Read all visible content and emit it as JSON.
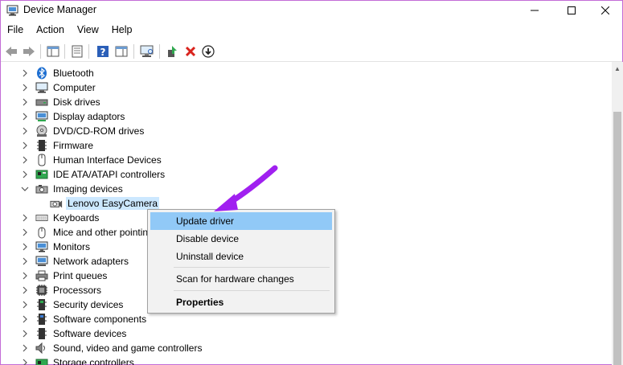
{
  "window": {
    "title": "Device Manager",
    "controls": {
      "minimize": "—",
      "maximize": "☐",
      "close": "✕"
    }
  },
  "menubar": {
    "items": [
      "File",
      "Action",
      "View",
      "Help"
    ]
  },
  "toolbar": {
    "buttons": [
      "back-icon",
      "forward-icon",
      "show-hide-console-tree-icon",
      "properties-icon",
      "help-icon",
      "action-pane-icon",
      "scan-hardware-icon",
      "enable-device-icon",
      "uninstall-device-icon",
      "update-driver-icon"
    ]
  },
  "tree": {
    "items": [
      {
        "label": "Bluetooth",
        "icon": "bluetooth-icon",
        "expanded": false
      },
      {
        "label": "Computer",
        "icon": "computer-icon",
        "expanded": false
      },
      {
        "label": "Disk drives",
        "icon": "disk-drive-icon",
        "expanded": false
      },
      {
        "label": "Display adaptors",
        "icon": "display-adapter-icon",
        "expanded": false
      },
      {
        "label": "DVD/CD-ROM drives",
        "icon": "dvd-drive-icon",
        "expanded": false
      },
      {
        "label": "Firmware",
        "icon": "firmware-icon",
        "expanded": false
      },
      {
        "label": "Human Interface Devices",
        "icon": "hid-icon",
        "expanded": false
      },
      {
        "label": "IDE ATA/ATAPI controllers",
        "icon": "ide-controller-icon",
        "expanded": false
      },
      {
        "label": "Imaging devices",
        "icon": "imaging-device-icon",
        "expanded": true
      },
      {
        "label": "Lenovo EasyCamera",
        "icon": "camera-icon",
        "child": true,
        "selected": true
      },
      {
        "label": "Keyboards",
        "icon": "keyboard-icon",
        "expanded": false
      },
      {
        "label": "Mice and other pointin",
        "icon": "mouse-icon",
        "expanded": false
      },
      {
        "label": "Monitors",
        "icon": "monitor-icon",
        "expanded": false
      },
      {
        "label": "Network adapters",
        "icon": "network-adapter-icon",
        "expanded": false
      },
      {
        "label": "Print queues",
        "icon": "printer-icon",
        "expanded": false
      },
      {
        "label": "Processors",
        "icon": "processor-icon",
        "expanded": false
      },
      {
        "label": "Security devices",
        "icon": "security-device-icon",
        "expanded": false
      },
      {
        "label": "Software components",
        "icon": "software-component-icon",
        "expanded": false
      },
      {
        "label": "Software devices",
        "icon": "software-device-icon",
        "expanded": false
      },
      {
        "label": "Sound, video and game controllers",
        "icon": "sound-icon",
        "expanded": false
      },
      {
        "label": "Storage controllers",
        "icon": "storage-controller-icon",
        "expanded": false
      }
    ]
  },
  "context_menu": {
    "items": [
      {
        "label": "Update driver",
        "highlighted": true
      },
      {
        "label": "Disable device"
      },
      {
        "label": "Uninstall device"
      },
      {
        "label": "Scan for hardware changes"
      },
      {
        "label": "Properties",
        "bold": true
      }
    ]
  },
  "colors": {
    "arrow": "#a020f0",
    "selection": "#cce8ff",
    "menu_highlight": "#91c9f7",
    "window_border": "#c36cd6"
  }
}
